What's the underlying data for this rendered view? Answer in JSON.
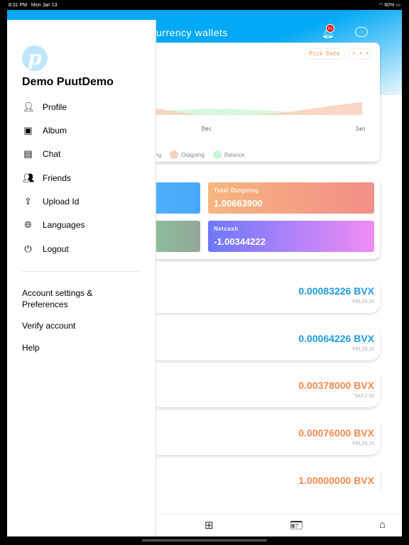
{
  "status": {
    "time": "8:31 PM",
    "date": "Mon Jan 13",
    "battery": "60%"
  },
  "header": {
    "title": "urrency  wallets",
    "notification_count": "61"
  },
  "chart": {
    "pick_date": "Pick Date",
    "more": "• • •",
    "x_ticks": [
      "Dec",
      "Jan"
    ],
    "legend": [
      {
        "label": "ming",
        "color": "#7dd3e8"
      },
      {
        "label": "Outgoing",
        "color": "#f8d2bd"
      },
      {
        "label": "Balance",
        "color": "#c9f7d4"
      }
    ]
  },
  "summary": {
    "outgoing_label": "Total Outgoing",
    "outgoing_value": "1.00663900",
    "netcash_label": "Netcash",
    "netcash_value": "-1.00344222"
  },
  "transactions": [
    {
      "amount": "0.00083226 BVX",
      "date": "FRI,29.10",
      "color": "#1e9be0"
    },
    {
      "amount": "0.00064226 BVX",
      "date": "FRI,29.10",
      "color": "#1e9be0"
    },
    {
      "amount": "0.00378000 BVX",
      "date": "SAT,2.10",
      "color": "#f5894f"
    },
    {
      "amount": "0.00076000 BVX",
      "date": "FRI,29.10",
      "color": "#f5894f"
    },
    {
      "amount": "1.00000000 BVX",
      "date": "",
      "color": "#f5894f"
    }
  ],
  "drawer": {
    "logo": "p",
    "user": "Demo PuutDemo",
    "items": [
      {
        "label": "Profile",
        "icon": "person-icon"
      },
      {
        "label": "Album",
        "icon": "album-icon"
      },
      {
        "label": "Chat",
        "icon": "chat-icon"
      },
      {
        "label": "Friends",
        "icon": "friends-icon"
      },
      {
        "label": "Upload Id",
        "icon": "upload-icon"
      },
      {
        "label": "Languages",
        "icon": "globe-icon"
      },
      {
        "label": "Logout",
        "icon": "power-icon"
      }
    ],
    "secondary": [
      "Account settings & Preferences",
      "Verify account",
      "Help"
    ]
  }
}
